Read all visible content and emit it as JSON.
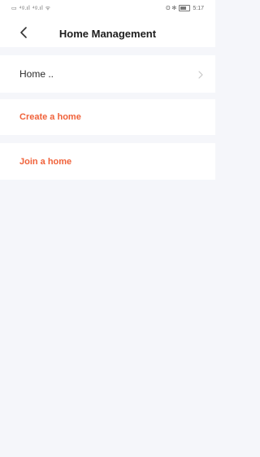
{
  "status_bar": {
    "left_text": "▭ ⁴ᵍ.ıl ⁴ᵍ.ıl ᯤ",
    "time": "5:17",
    "right_icons": "ʘ ✻"
  },
  "header": {
    "title": "Home Management",
    "back_icon": "chevron-left-icon"
  },
  "homes": [
    {
      "label": "Home .."
    }
  ],
  "actions": {
    "create_label": "Create a home",
    "join_label": "Join a home"
  },
  "colors": {
    "accent": "#f0623a",
    "background": "#f5f6fa",
    "card": "#ffffff"
  }
}
